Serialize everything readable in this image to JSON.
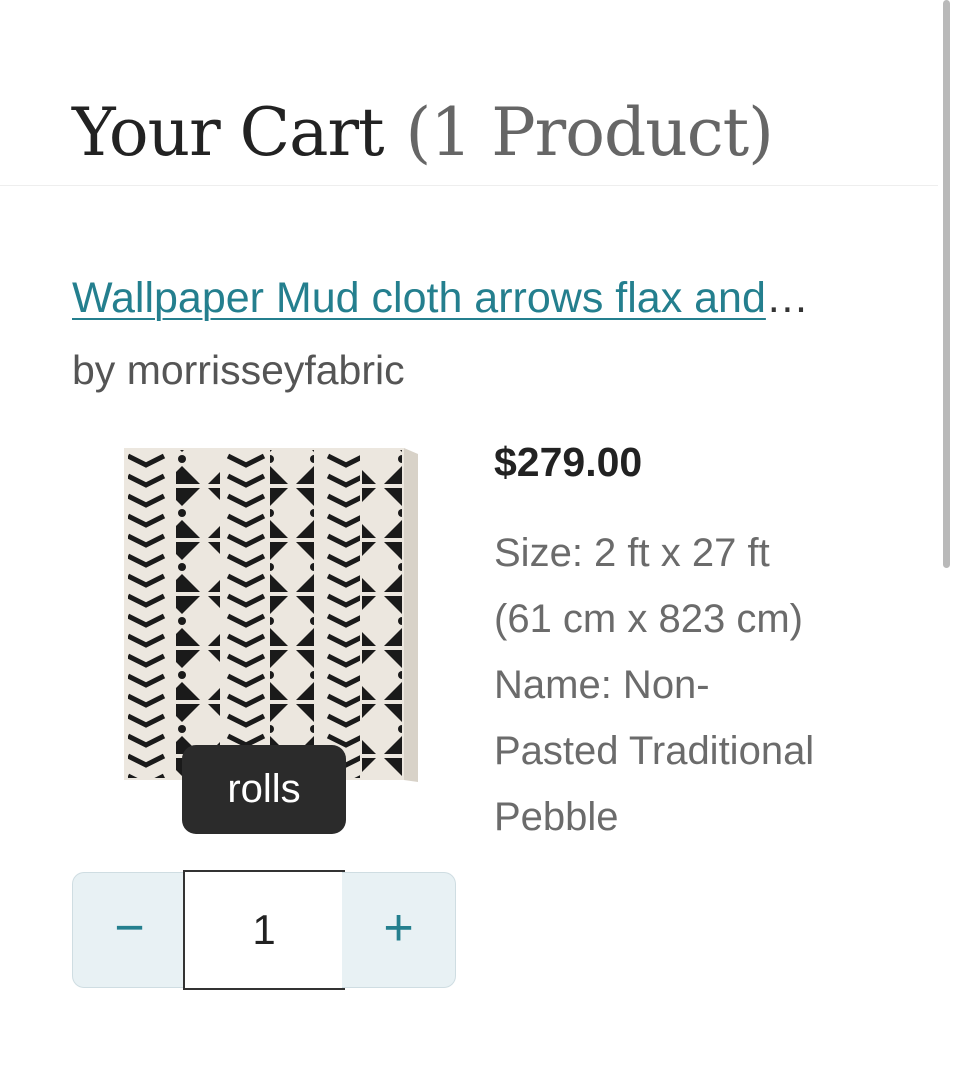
{
  "header": {
    "title": "Your Cart",
    "count": "(1 Product)"
  },
  "item": {
    "title": "Wallpaper Mud cloth arrows flax and",
    "title_ellipsis": "…",
    "by": "by morrisseyfabric",
    "thumbnail_badge": "rolls",
    "thumbnail_icon": "wallpaper-roll-mudcloth-pattern",
    "price": "$279.00",
    "details": [
      "Size: 2 ft x 27 ft",
      "(61 cm x 823 cm)",
      "Name: Non-",
      "Pasted Traditional",
      "Pebble"
    ],
    "quantity": {
      "minus_label": "−",
      "value": "1",
      "plus_label": "+"
    }
  },
  "colors": {
    "accent": "#247f8e",
    "stepper_bg": "#e8f1f4",
    "wallpaper_bg": "#ece7df",
    "pattern_ink": "#1a1a1a"
  }
}
